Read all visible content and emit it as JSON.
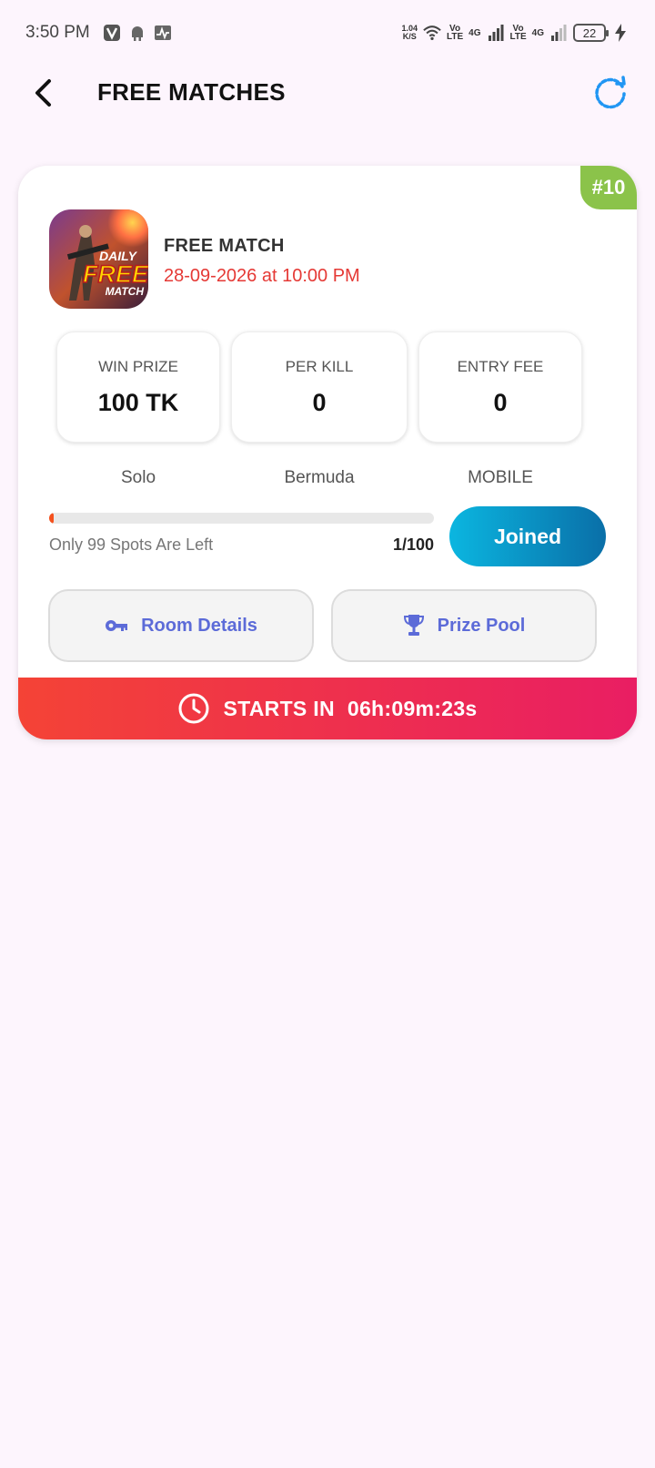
{
  "status_bar": {
    "time": "3:50 PM",
    "net_speed_value": "1.04",
    "net_speed_unit": "K/S",
    "sim1_top": "Vo",
    "sim1_bottom": "LTE",
    "sim1_network": "4G",
    "sim2_top": "Vo",
    "sim2_bottom": "LTE",
    "sim2_network": "4G",
    "battery_level": "22"
  },
  "header": {
    "title": "FREE MATCHES"
  },
  "match": {
    "number": "#10",
    "title": "FREE MATCH",
    "datetime": "28-09-2026 at 10:00 PM",
    "thumb_text_1": "DAILY",
    "thumb_text_2": "FREE",
    "thumb_text_3": "MATCH",
    "stats": {
      "win_prize_label": "WIN PRIZE",
      "win_prize_value": "100 TK",
      "per_kill_label": "PER KILL",
      "per_kill_value": "0",
      "entry_fee_label": "ENTRY FEE",
      "entry_fee_value": "0"
    },
    "type": "Solo",
    "map": "Bermuda",
    "platform": "MOBILE",
    "spots_left": "Only 99 Spots Are Left",
    "spots_count": "1/100",
    "progress_fraction": 0.01,
    "joined_label": "Joined",
    "room_details_label": "Room Details",
    "prize_pool_label": "Prize Pool",
    "countdown_label": "STARTS IN",
    "countdown_value": "06h:09m:23s"
  },
  "colors": {
    "accent_blue": "#5C6BD8",
    "date_red": "#E53935",
    "badge_green": "#8BC34A"
  },
  "icons": [
    "back-arrow-icon",
    "refresh-icon",
    "key-icon",
    "trophy-icon",
    "clock-icon"
  ]
}
